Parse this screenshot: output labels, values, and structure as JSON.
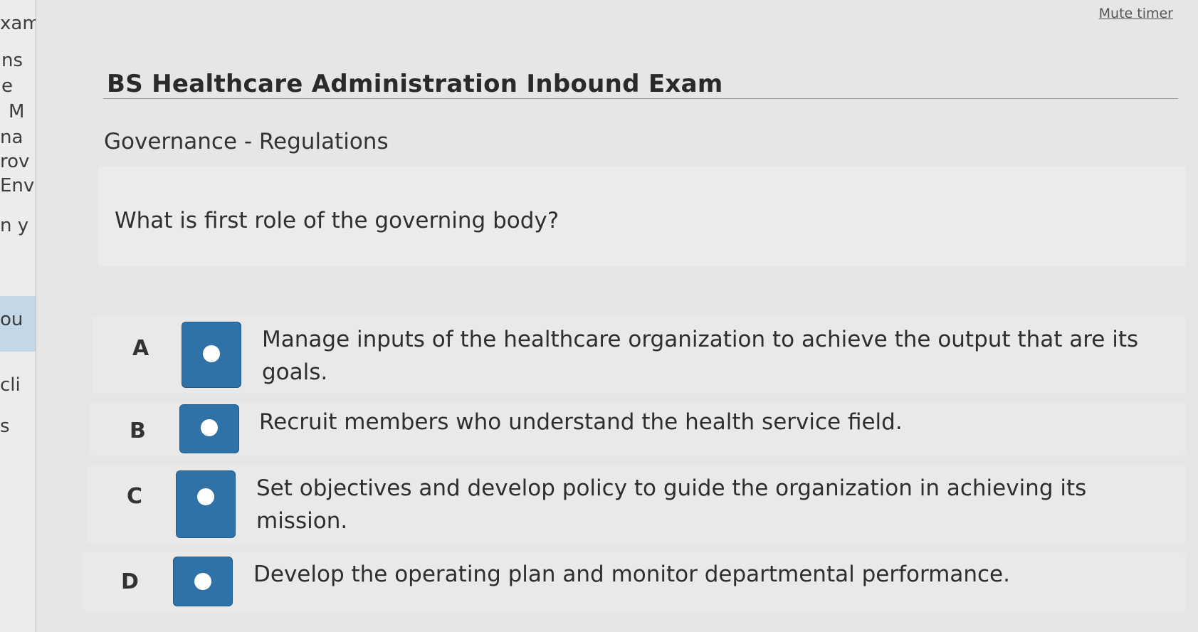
{
  "sidebar": {
    "fragments": [
      "xam",
      "ns",
      "e",
      "M",
      "na",
      "rov",
      "Env",
      "n y",
      "ou",
      "cli",
      "s"
    ]
  },
  "header": {
    "mute_label": "Mute timer"
  },
  "exam": {
    "title": "BS Healthcare Administration Inbound Exam",
    "section": "Governance - Regulations",
    "question": "What is first role of the governing body?"
  },
  "options": [
    {
      "letter": "A",
      "text": "Manage inputs of the healthcare organization to achieve the output that are its goals."
    },
    {
      "letter": "B",
      "text": "Recruit members who understand the health service field."
    },
    {
      "letter": "C",
      "text": "Set objectives and develop policy to guide the organization in achieving its mission."
    },
    {
      "letter": "D",
      "text": "Develop the operating plan and monitor departmental performance."
    }
  ],
  "colors": {
    "radio_blue": "#2f72a8",
    "background": "#e6e6e6"
  }
}
